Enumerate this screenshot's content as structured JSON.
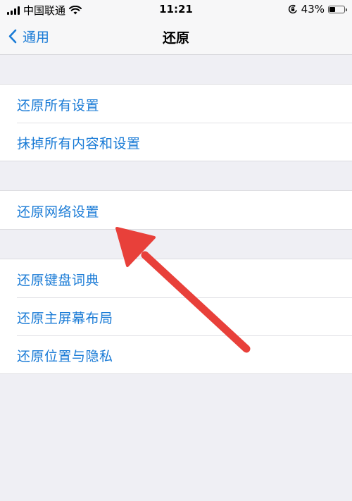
{
  "status_bar": {
    "carrier": "中国联通",
    "time": "11:21",
    "battery_percent": "43%",
    "battery_level": 0.43,
    "icons": [
      "signal-icon",
      "wifi-icon",
      "orientation-lock-icon",
      "battery-icon"
    ]
  },
  "nav": {
    "back_label": "通用",
    "title": "还原"
  },
  "groups": [
    {
      "items": [
        "还原所有设置",
        "抹掉所有内容和设置"
      ]
    },
    {
      "items": [
        "还原网络设置"
      ]
    },
    {
      "items": [
        "还原键盘词典",
        "还原主屏幕布局",
        "还原位置与隐私"
      ]
    }
  ],
  "colors": {
    "accent": "#1a7bd6",
    "annotation_arrow": "#e8403a",
    "background": "#efeff4"
  }
}
